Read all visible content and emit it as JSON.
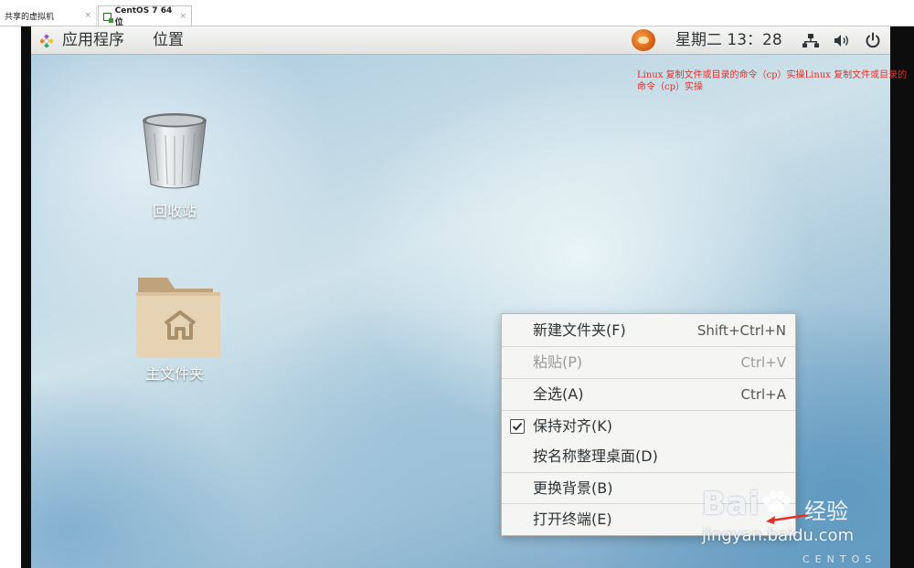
{
  "vm_tabs": [
    {
      "label": "共享的虚拟机",
      "close": "×",
      "active": false
    },
    {
      "label": "CentOS 7 64 位",
      "close": "×",
      "active": true
    }
  ],
  "topbar": {
    "apps_menu": "应用程序",
    "places_menu": "位置",
    "datetime": "星期二 13：28",
    "icons": [
      "apps-icon",
      "tray-app-icon",
      "network-icon",
      "volume-icon",
      "power-icon"
    ]
  },
  "annotation": "Linux 复制文件或目录的命令（cp）实操Linux 复制文件或目录的命令（cp）实操",
  "desktop_icons": [
    {
      "label": "回收站",
      "icon": "trash-icon"
    },
    {
      "label": "主文件夹",
      "icon": "home-folder-icon"
    }
  ],
  "context_menu": {
    "items": [
      {
        "label": "新建文件夹(F)",
        "accel": "Shift+Ctrl+N",
        "enabled": true
      },
      {
        "label": "粘贴(P)",
        "accel": "Ctrl+V",
        "enabled": false
      },
      {
        "label": "全选(A)",
        "accel": "Ctrl+A",
        "enabled": true
      },
      {
        "label": "保持对齐(K)",
        "accel": "",
        "enabled": true,
        "checked": true
      },
      {
        "label": "按名称整理桌面(D)",
        "accel": "",
        "enabled": true
      },
      {
        "label": "更换背景(B)",
        "accel": "",
        "enabled": true
      },
      {
        "label": "打开终端(E)",
        "accel": "",
        "enabled": true
      }
    ]
  },
  "watermark": {
    "brand": "Bai",
    "brand_cn": "经验",
    "url": "jingyan.baidu.com",
    "centos": "CENTOS"
  },
  "colors": {
    "annotation_red": "#e0322b",
    "arrow_red": "#e0322b",
    "topbar_bg": "#ececeb",
    "menu_bg": "#f5f5f4"
  }
}
